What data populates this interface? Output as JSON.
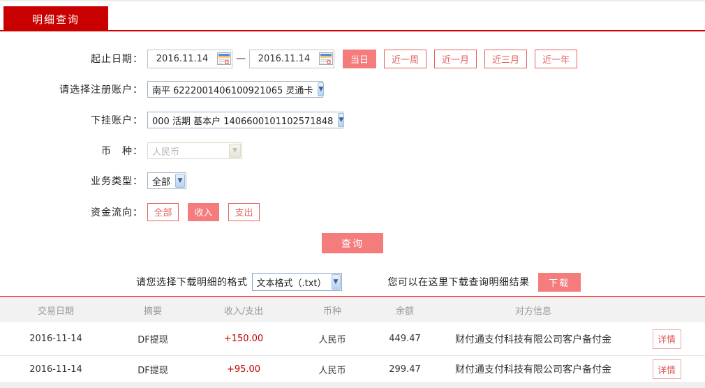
{
  "tab": {
    "label": "明细查询"
  },
  "form": {
    "date_row": {
      "label": "起止日期：",
      "start_date": "2016.11.14",
      "separator": "—",
      "end_date": "2016.11.14",
      "quick_buttons": [
        {
          "label": "当日",
          "active": true
        },
        {
          "label": "近一周",
          "active": false
        },
        {
          "label": "近一月",
          "active": false
        },
        {
          "label": "近三月",
          "active": false
        },
        {
          "label": "近一年",
          "active": false
        }
      ]
    },
    "register_account": {
      "label": "请选择注册账户：",
      "value": "南平 6222001406100921065 灵通卡"
    },
    "sub_account": {
      "label": "下挂账户：",
      "value": "000 活期 基本户 1406600101102571848"
    },
    "currency": {
      "label": "币　种：",
      "value": "人民币",
      "disabled": true
    },
    "business_type": {
      "label": "业务类型：",
      "value": "全部"
    },
    "fund_flow": {
      "label": "资金流向：",
      "options": [
        {
          "label": "全部",
          "active": false
        },
        {
          "label": "收入",
          "active": true
        },
        {
          "label": "支出",
          "active": false
        }
      ]
    },
    "query_button": "查询"
  },
  "download": {
    "format_label": "请您选择下载明细的格式",
    "format_value": "文本格式（.txt）",
    "hint": "您可以在这里下载查询明细结果",
    "button": "下载"
  },
  "table": {
    "headers": [
      "交易日期",
      "摘要",
      "收入/支出",
      "币种",
      "余额",
      "对方信息"
    ],
    "rows": [
      {
        "date": "2016-11-14",
        "summary": "DF提现",
        "amount": "+150.00",
        "currency": "人民币",
        "balance": "449.47",
        "counterparty": "财付通支付科技有限公司客户备付金",
        "action": "详情"
      },
      {
        "date": "2016-11-14",
        "summary": "DF提现",
        "amount": "+95.00",
        "currency": "人民币",
        "balance": "299.47",
        "counterparty": "财付通支付科技有限公司客户备付金",
        "action": "详情"
      }
    ]
  },
  "colors": {
    "tab_red": "#c90000",
    "button_pink": "#f47c7c",
    "outline_red": "#e56060",
    "amount_red": "#c00000",
    "divider_salmon": "#ec5e5e",
    "header_gray_bg": "#f2f2f2"
  }
}
